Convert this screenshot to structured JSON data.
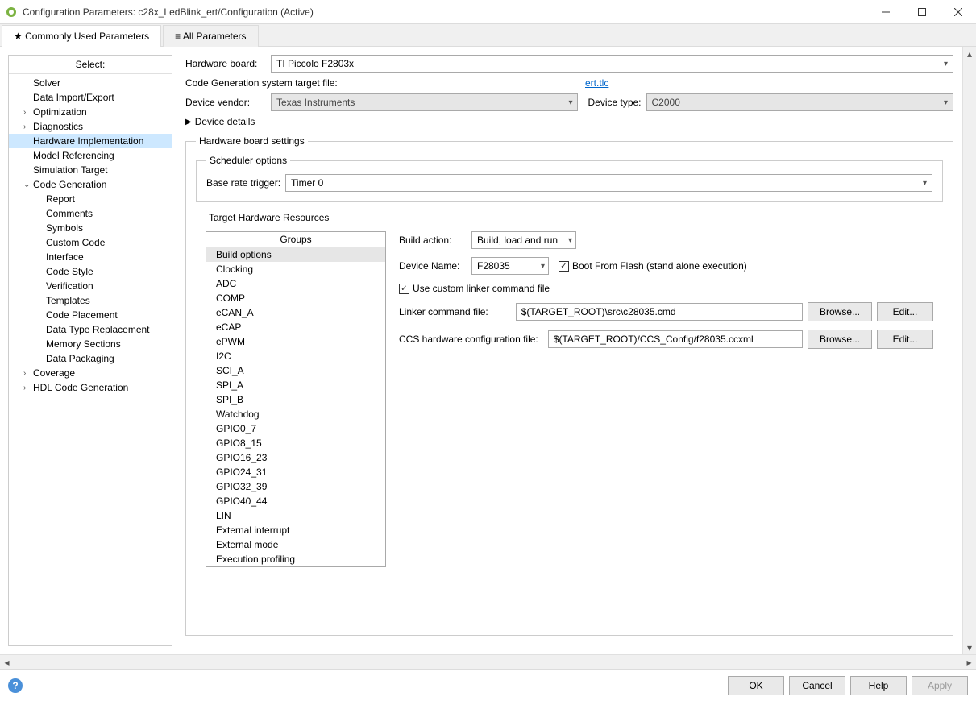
{
  "window": {
    "title": "Configuration Parameters: c28x_LedBlink_ert/Configuration (Active)"
  },
  "tabs": {
    "commonly": "★ Commonly Used Parameters",
    "all": "≡ All Parameters"
  },
  "sidebar": {
    "select": "Select:",
    "items": [
      {
        "label": "Solver",
        "lvl": 1
      },
      {
        "label": "Data Import/Export",
        "lvl": 1
      },
      {
        "label": "Optimization",
        "lvl": 1,
        "exp": "›"
      },
      {
        "label": "Diagnostics",
        "lvl": 1,
        "exp": "›"
      },
      {
        "label": "Hardware Implementation",
        "lvl": 1,
        "selected": true
      },
      {
        "label": "Model Referencing",
        "lvl": 1
      },
      {
        "label": "Simulation Target",
        "lvl": 1
      },
      {
        "label": "Code Generation",
        "lvl": 1,
        "exp": "⌄"
      },
      {
        "label": "Report",
        "lvl": 2
      },
      {
        "label": "Comments",
        "lvl": 2
      },
      {
        "label": "Symbols",
        "lvl": 2
      },
      {
        "label": "Custom Code",
        "lvl": 2
      },
      {
        "label": "Interface",
        "lvl": 2
      },
      {
        "label": "Code Style",
        "lvl": 2
      },
      {
        "label": "Verification",
        "lvl": 2
      },
      {
        "label": "Templates",
        "lvl": 2
      },
      {
        "label": "Code Placement",
        "lvl": 2
      },
      {
        "label": "Data Type Replacement",
        "lvl": 2
      },
      {
        "label": "Memory Sections",
        "lvl": 2
      },
      {
        "label": "Data Packaging",
        "lvl": 2
      },
      {
        "label": "Coverage",
        "lvl": 1,
        "exp": "›"
      },
      {
        "label": "HDL Code Generation",
        "lvl": 1,
        "exp": "›"
      }
    ]
  },
  "content": {
    "hw_board_label": "Hardware board:",
    "hw_board_value": "TI Piccolo F2803x",
    "cg_label": "Code Generation system target file:",
    "cg_link": "ert.tlc",
    "dv_label": "Device vendor:",
    "dv_value": "Texas Instruments",
    "dt_label": "Device type:",
    "dt_value": "C2000",
    "details": "Device details",
    "hbs_legend": "Hardware board settings",
    "sched_legend": "Scheduler options",
    "brt_label": "Base rate trigger:",
    "brt_value": "Timer 0",
    "thr_legend": "Target Hardware Resources",
    "groups_hdr": "Groups",
    "groups": [
      "Build options",
      "Clocking",
      "ADC",
      "COMP",
      "eCAN_A",
      "eCAP",
      "ePWM",
      "I2C",
      "SCI_A",
      "SPI_A",
      "SPI_B",
      "Watchdog",
      "GPIO0_7",
      "GPIO8_15",
      "GPIO16_23",
      "GPIO24_31",
      "GPIO32_39",
      "GPIO40_44",
      "LIN",
      "External interrupt",
      "External mode",
      "Execution profiling"
    ],
    "build_action_label": "Build action:",
    "build_action_value": "Build, load and run",
    "device_name_label": "Device Name:",
    "device_name_value": "F28035",
    "boot_flash": "Boot From Flash (stand alone execution)",
    "use_linker": "Use custom linker command file",
    "lcf_label": "Linker command file:",
    "lcf_value": "$(TARGET_ROOT)\\src\\c28035.cmd",
    "ccs_label": "CCS hardware configuration file:",
    "ccs_value": "$(TARGET_ROOT)/CCS_Config/f28035.ccxml",
    "browse": "Browse...",
    "edit": "Edit..."
  },
  "footer": {
    "ok": "OK",
    "cancel": "Cancel",
    "help": "Help",
    "apply": "Apply"
  }
}
